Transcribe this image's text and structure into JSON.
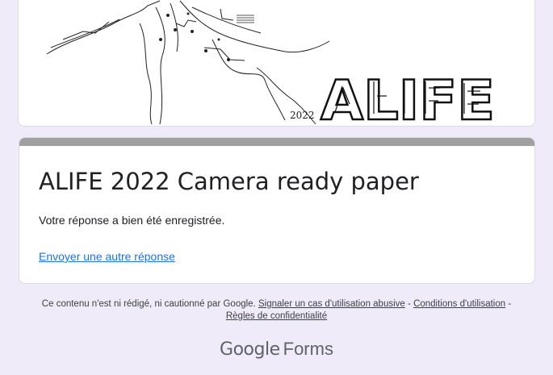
{
  "banner": {
    "year": "2022",
    "logo_text": "ALIFE",
    "logo_color": "#111111"
  },
  "form": {
    "title": "ALIFE 2022 Camera ready paper",
    "confirmation": "Votre réponse a bien été enregistrée.",
    "resubmit_label": "Envoyer une autre réponse",
    "accent_color": "#a0a0a0",
    "link_color": "#1a73e8"
  },
  "footer": {
    "disclaimer": "Ce contenu n'est ni rédigé, ni cautionné par Google.",
    "report_abuse": "Signaler un cas d'utilisation abusive",
    "separator": "-",
    "terms": "Conditions d'utilisation",
    "privacy": "Règles de confidentialité"
  },
  "brand": {
    "google": "Google",
    "forms": "Forms"
  }
}
